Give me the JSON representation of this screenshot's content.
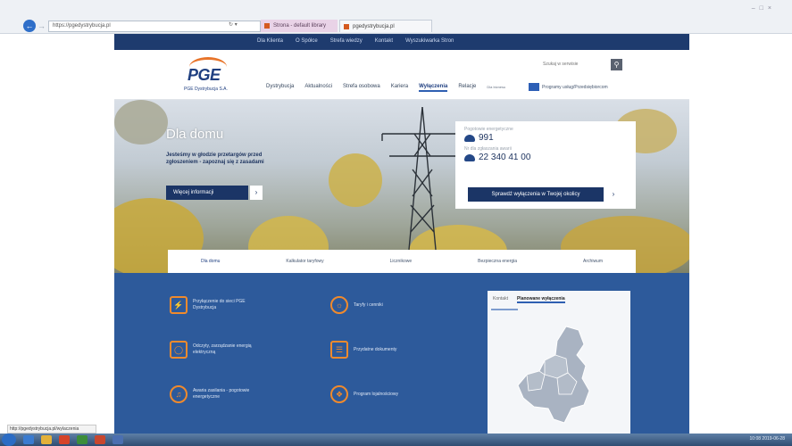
{
  "browser": {
    "address": "https://pgedystrybucja.pl",
    "tabs": [
      {
        "label": "Strona - default library"
      },
      {
        "label": "pgedystrybucja.pl"
      }
    ]
  },
  "site": {
    "topnav": [
      "Dla Klienta",
      "O Spółce",
      "Strefa wiedzy",
      "Kontakt",
      "Wyszukiwarka Stron"
    ],
    "logo": {
      "brand": "PGE",
      "name": "PGE Dystrybucja S.A."
    },
    "mainnav": [
      {
        "label": "Dystrybucja"
      },
      {
        "label": "Aktualności"
      },
      {
        "label": "Strefa osobowa"
      },
      {
        "label": "Kariera"
      },
      {
        "label": "Wyłączenia",
        "active": true
      },
      {
        "label": "Relacje"
      }
    ],
    "mainnav_category": "Dla biznesu",
    "program_label": "Programy usług/Przedsiębiorcom",
    "search_placeholder": "Szukaj w serwisie",
    "hero": {
      "title": "Dla domu",
      "text": "Jesteśmy w głodzie przetargów przed zgłoszeniem - zapoznaj się z zasadami",
      "button": "Więcej informacji"
    },
    "emergency": {
      "label1": "Pogotowie energetyczne",
      "number1": "991",
      "label2": "Nr dla zgłaszania awarii",
      "number2": "22 340 41 00",
      "button": "Sprawdź wyłączenia w Twojej okolicy"
    },
    "subtabs": [
      {
        "label": "Dla domu",
        "active": true
      },
      {
        "label": "Kalkulator taryfowy"
      },
      {
        "label": "Licznikowe"
      },
      {
        "label": "Bezpieczna energia"
      },
      {
        "label": "Archiwum"
      }
    ],
    "services": [
      {
        "label": "Przyłączenie do sieci PGE Dystrybucja",
        "icon": "plug-icon"
      },
      {
        "label": "Taryfy i cenniki",
        "icon": "bulb-icon"
      },
      {
        "label": "Odczyty, zarządzanie energią elektryczną",
        "icon": "meter-icon"
      },
      {
        "label": "Przydatne dokumenty",
        "icon": "document-icon"
      },
      {
        "label": "Awaria zasilania - pogotowie energetyczne",
        "icon": "bell-icon"
      },
      {
        "label": "Program lojalnościowy",
        "icon": "gift-icon"
      }
    ],
    "map": {
      "tabs": [
        {
          "label": "Kontakt"
        },
        {
          "label": "Planowane wyłączenia",
          "active": true
        }
      ]
    }
  },
  "statusbar": {
    "url": "http://pgedystrybucja.pl/wylaczenia"
  },
  "tray": {
    "text": "10:08  2019-06-28"
  }
}
